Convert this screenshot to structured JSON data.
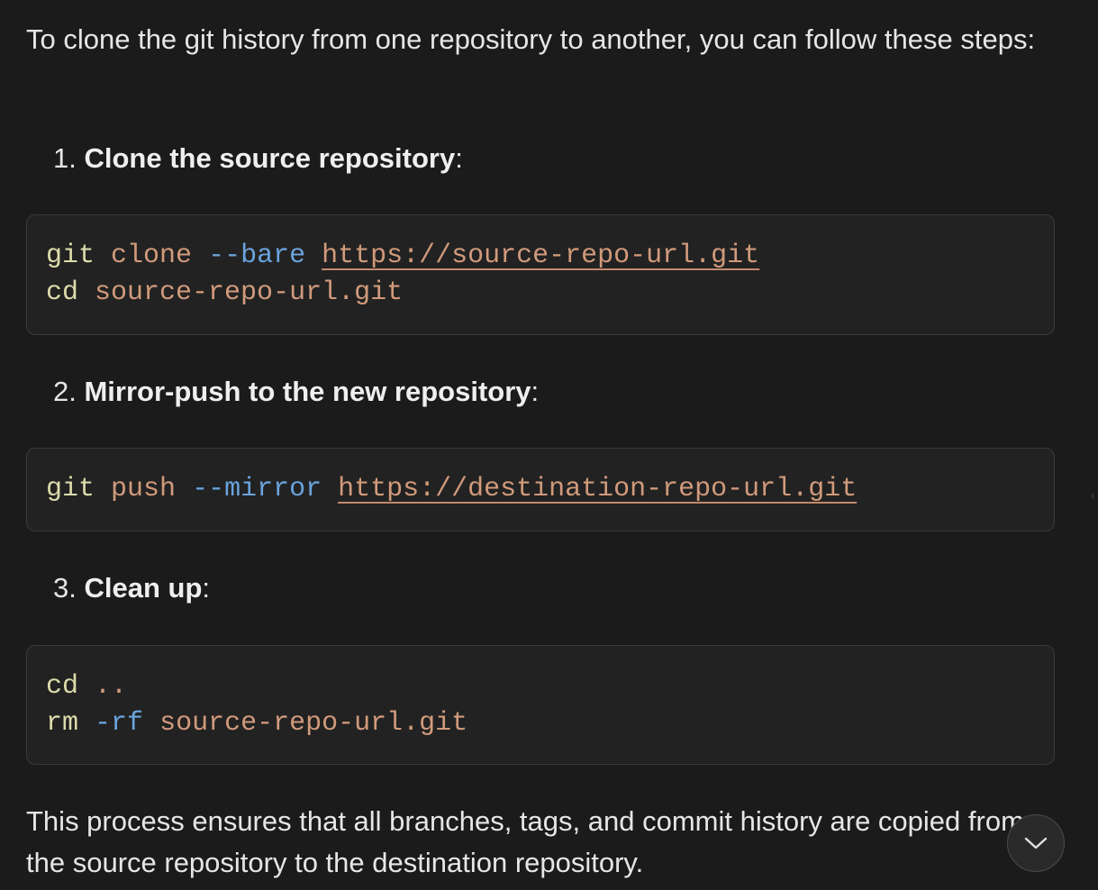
{
  "intro_text": "To clone the git history from one repository to another, you can follow these steps:",
  "steps": [
    {
      "number": "1.",
      "title": "Clone the source repository",
      "suffix": ":",
      "code_lines": [
        [
          {
            "type": "cmd",
            "text": "git"
          },
          {
            "type": "sp",
            "text": " "
          },
          {
            "type": "str",
            "text": "clone"
          },
          {
            "type": "sp",
            "text": " "
          },
          {
            "type": "flag",
            "text": "--bare"
          },
          {
            "type": "sp",
            "text": " "
          },
          {
            "type": "url",
            "text": "https://source-repo-url.git"
          }
        ],
        [
          {
            "type": "cmd",
            "text": "cd"
          },
          {
            "type": "sp",
            "text": " "
          },
          {
            "type": "str",
            "text": "source-repo-url.git"
          }
        ]
      ]
    },
    {
      "number": "2.",
      "title": "Mirror-push to the new repository",
      "suffix": ":",
      "code_lines": [
        [
          {
            "type": "cmd",
            "text": "git"
          },
          {
            "type": "sp",
            "text": " "
          },
          {
            "type": "str",
            "text": "push"
          },
          {
            "type": "sp",
            "text": " "
          },
          {
            "type": "flag",
            "text": "--mirror"
          },
          {
            "type": "sp",
            "text": " "
          },
          {
            "type": "url",
            "text": "https://destination-repo-url.git"
          }
        ]
      ]
    },
    {
      "number": "3.",
      "title": "Clean up",
      "suffix": ":",
      "code_lines": [
        [
          {
            "type": "cmd",
            "text": "cd"
          },
          {
            "type": "sp",
            "text": " "
          },
          {
            "type": "str",
            "text": ".."
          }
        ],
        [
          {
            "type": "cmd",
            "text": "rm"
          },
          {
            "type": "sp",
            "text": " "
          },
          {
            "type": "flag",
            "text": "-rf"
          },
          {
            "type": "sp",
            "text": " "
          },
          {
            "type": "str",
            "text": "source-repo-url.git"
          }
        ]
      ]
    }
  ],
  "outro_text": "This process ensures that all branches, tags, and commit history are copied from the source repository to the destination repository.",
  "scroll_button": {
    "icon": "chevron-down-icon"
  },
  "colors": {
    "background": "#1b1b1b",
    "code_background": "#222222",
    "command": "#dcdcaa",
    "string": "#d19a7b",
    "flag": "#6aa3dd"
  }
}
